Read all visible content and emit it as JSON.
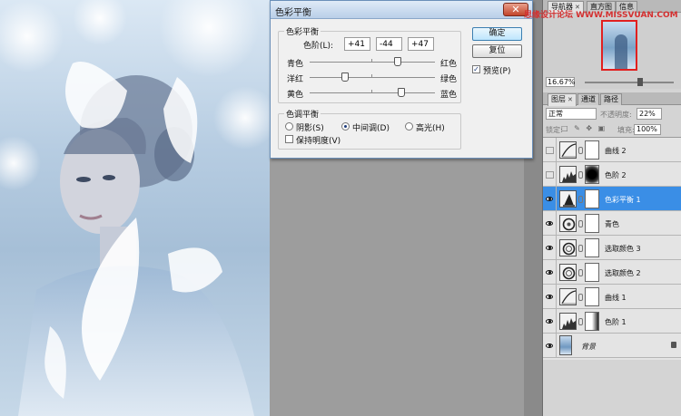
{
  "dialog": {
    "title": "色彩平衡",
    "close_label": "✕",
    "color_balance_group": "色彩平衡",
    "levels_label": "色阶(L):",
    "levels": [
      "+41",
      "-44",
      "+47"
    ],
    "sliders": [
      {
        "left": "青色",
        "right": "红色",
        "value": 41
      },
      {
        "left": "洋红",
        "right": "绿色",
        "value": -44
      },
      {
        "left": "黄色",
        "right": "蓝色",
        "value": 47
      }
    ],
    "tone_group": "色调平衡",
    "tones": [
      {
        "label": "阴影(S)",
        "checked": false
      },
      {
        "label": "中间调(D)",
        "checked": true
      },
      {
        "label": "高光(H)",
        "checked": false
      }
    ],
    "preserve_luminosity": "保持明度(V)",
    "ok_label": "确定",
    "reset_label": "复位",
    "preview_label": "预览(P)",
    "preview_mark": "✓"
  },
  "watermark": "思缘设计论坛 WWW.MISSVUAN.COM",
  "navigator": {
    "tabs": [
      {
        "label": "导航器"
      },
      {
        "label": "直方图"
      },
      {
        "label": "信息"
      }
    ],
    "zoom": "16.67%"
  },
  "layers_panel": {
    "tabs": [
      {
        "label": "图层"
      },
      {
        "label": "通道"
      },
      {
        "label": "路径"
      }
    ],
    "blend_mode": "正常",
    "opacity_label": "不透明度:",
    "opacity": "22%",
    "lock_label": "锁定:",
    "fill_label": "填充:",
    "fill": "100%",
    "layers": [
      {
        "name": "曲线 2",
        "visible": false,
        "selected": false,
        "icon": "curves-icon",
        "mask": "white"
      },
      {
        "name": "色阶 2",
        "visible": false,
        "selected": false,
        "icon": "levels-icon",
        "mask": "black"
      },
      {
        "name": "色彩平衡 1",
        "visible": true,
        "selected": true,
        "icon": "color-balance-icon",
        "mask": "white"
      },
      {
        "name": "青色",
        "visible": true,
        "selected": false,
        "icon": "hue-icon",
        "mask": "white"
      },
      {
        "name": "选取颜色 3",
        "visible": true,
        "selected": false,
        "icon": "selective-color-icon",
        "mask": "white"
      },
      {
        "name": "选取颜色 2",
        "visible": true,
        "selected": false,
        "icon": "selective-color-icon",
        "mask": "white"
      },
      {
        "name": "曲线 1",
        "visible": true,
        "selected": false,
        "icon": "curves-icon",
        "mask": "white"
      },
      {
        "name": "色阶 1",
        "visible": true,
        "selected": false,
        "icon": "levels-icon",
        "mask": "grad"
      }
    ],
    "background_layer": "背景"
  }
}
